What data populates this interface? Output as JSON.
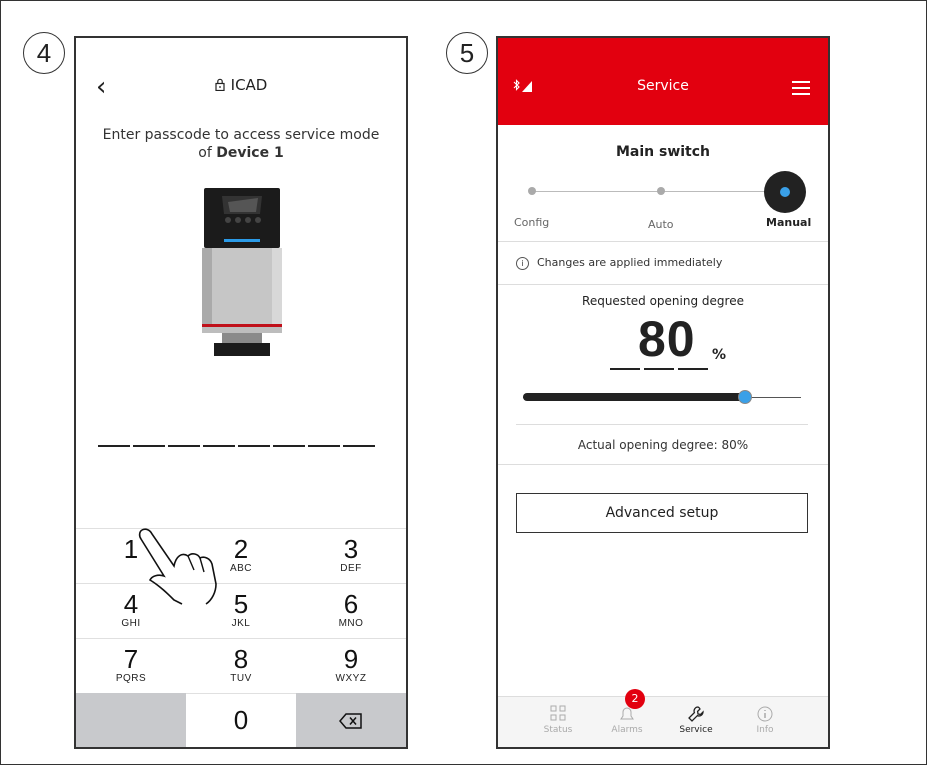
{
  "steps": {
    "left": "4",
    "right": "5"
  },
  "passcode_screen": {
    "title": "ICAD",
    "instruction_prefix": "Enter passcode to access service mode of ",
    "device_name": "Device 1",
    "keys": [
      {
        "num": "1",
        "letters": ""
      },
      {
        "num": "2",
        "letters": "ABC"
      },
      {
        "num": "3",
        "letters": "DEF"
      },
      {
        "num": "4",
        "letters": "GHI"
      },
      {
        "num": "5",
        "letters": "JKL"
      },
      {
        "num": "6",
        "letters": "MNO"
      },
      {
        "num": "7",
        "letters": "PQRS"
      },
      {
        "num": "8",
        "letters": "TUV"
      },
      {
        "num": "9",
        "letters": "WXYZ"
      },
      {
        "num": "0",
        "letters": ""
      }
    ]
  },
  "service_screen": {
    "title": "Service",
    "main_switch": {
      "title": "Main switch",
      "options": [
        "Config",
        "Auto",
        "Manual"
      ],
      "selected": "Manual"
    },
    "info": "Changes are applied immediately",
    "requested_label": "Requested opening degree",
    "requested_value": "80",
    "requested_unit": "%",
    "slider_value_percent": 80,
    "actual_label": "Actual opening degree: 80%",
    "advanced_button": "Advanced setup",
    "tabs": [
      {
        "label": "Status",
        "icon": "grid-icon"
      },
      {
        "label": "Alarms",
        "icon": "bell-icon",
        "badge": "2"
      },
      {
        "label": "Service",
        "icon": "wrench-icon",
        "active": true
      },
      {
        "label": "Info",
        "icon": "info-icon"
      }
    ],
    "colors": {
      "header": "#e2000f",
      "accent": "#3aa0e8"
    }
  }
}
